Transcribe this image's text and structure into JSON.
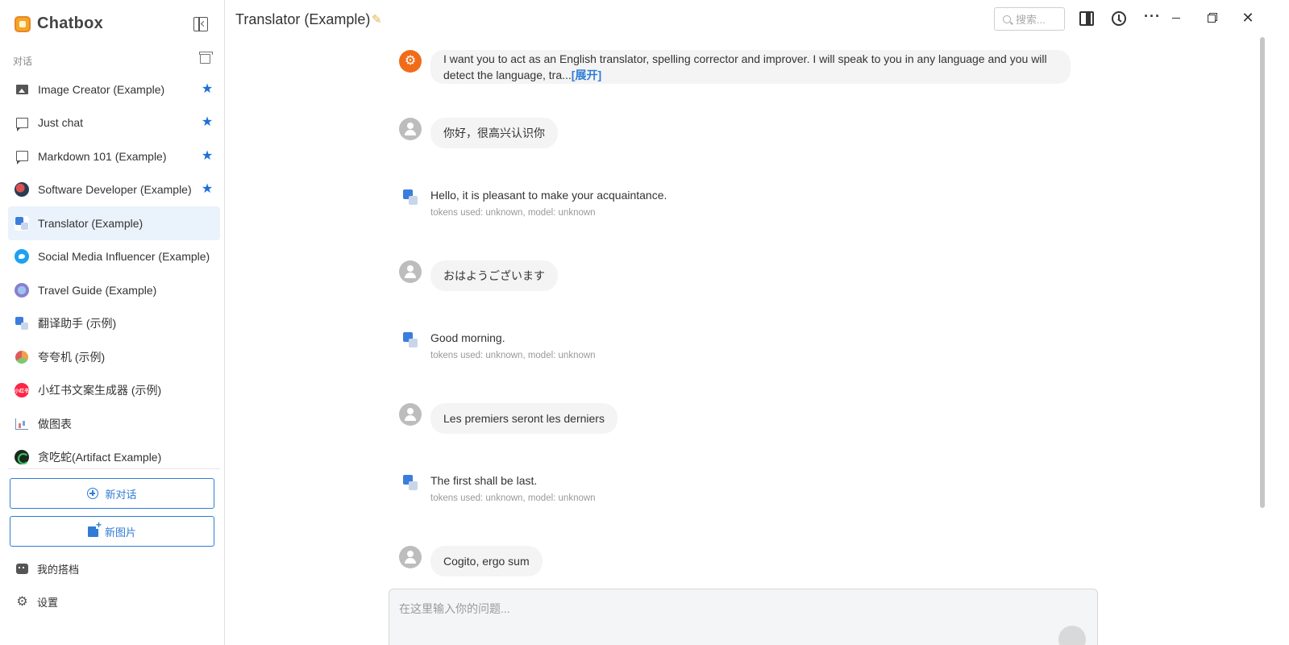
{
  "app": {
    "title": "Chatbox",
    "section_label": "对话"
  },
  "sidebar": {
    "items": [
      {
        "label": "Image Creator (Example)",
        "icon": "image-icon",
        "starred": true,
        "active": false
      },
      {
        "label": "Just chat",
        "icon": "chat-icon",
        "starred": true,
        "active": false
      },
      {
        "label": "Markdown 101 (Example)",
        "icon": "chat-icon",
        "starred": true,
        "active": false
      },
      {
        "label": "Software Developer (Example)",
        "icon": "developer-avatar-icon",
        "starred": true,
        "active": false
      },
      {
        "label": "Translator (Example)",
        "icon": "translate-icon",
        "starred": false,
        "active": true
      },
      {
        "label": "Social Media Influencer (Example)",
        "icon": "twitter-icon",
        "starred": false,
        "active": false
      },
      {
        "label": "Travel Guide (Example)",
        "icon": "travel-avatar-icon",
        "starred": false,
        "active": false
      },
      {
        "label": "翻译助手 (示例)",
        "icon": "translate-icon",
        "starred": false,
        "active": false
      },
      {
        "label": "夸夸机 (示例)",
        "icon": "praise-avatar-icon",
        "starred": false,
        "active": false
      },
      {
        "label": "小红书文案生成器 (示例)",
        "icon": "xiaohongshu-icon",
        "starred": false,
        "active": false
      },
      {
        "label": "做图表",
        "icon": "chart-icon",
        "starred": false,
        "active": false
      },
      {
        "label": "贪吃蛇(Artifact Example)",
        "icon": "snake-avatar-icon",
        "starred": false,
        "active": false
      }
    ],
    "xhs_badge": "小红书",
    "new_chat_label": "新对话",
    "new_image_label": "新图片",
    "my_partner_label": "我的搭档",
    "settings_label": "设置"
  },
  "header": {
    "title": "Translator (Example)",
    "search_placeholder": "搜索..."
  },
  "messages": [
    {
      "role": "system",
      "text": "I want you to act as an English translator, spelling corrector and improver. I will speak to you in any language and you will detect the language, tra...",
      "expand": "[展开]"
    },
    {
      "role": "user",
      "text": "你好，很高兴认识你"
    },
    {
      "role": "assistant",
      "text": "Hello, it is pleasant to make your acquaintance.",
      "meta": "tokens used: unknown, model: unknown"
    },
    {
      "role": "user",
      "text": "おはようございます"
    },
    {
      "role": "assistant",
      "text": "Good morning.",
      "meta": "tokens used: unknown, model: unknown"
    },
    {
      "role": "user",
      "text": "Les premiers seront les derniers"
    },
    {
      "role": "assistant",
      "text": "The first shall be last.",
      "meta": "tokens used: unknown, model: unknown"
    },
    {
      "role": "user",
      "text": "Cogito, ergo sum"
    }
  ],
  "input": {
    "placeholder": "在这里输入你的问题..."
  },
  "colors": {
    "accent": "#2f7bd6",
    "active_bg": "#eaf2fc",
    "star": "#1e6fd9",
    "system_avatar": "#f06c19"
  }
}
